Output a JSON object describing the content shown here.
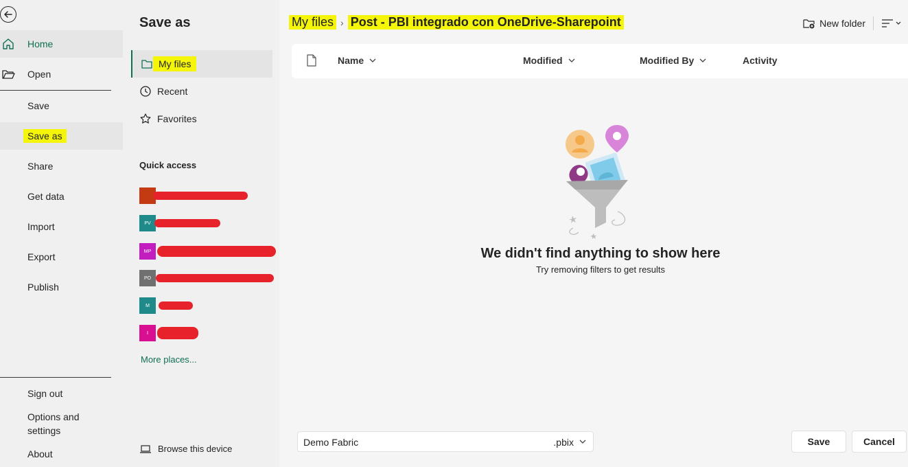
{
  "nav": {
    "home": "Home",
    "open": "Open",
    "save": "Save",
    "save_as": "Save as",
    "share": "Share",
    "get_data": "Get data",
    "import": "Import",
    "export": "Export",
    "publish": "Publish",
    "sign_out": "Sign out",
    "options_line1": "Options and",
    "options_line2": "settings",
    "about": "About"
  },
  "panel": {
    "title": "Save as",
    "locations": [
      "My files",
      "Recent",
      "Favorites"
    ],
    "quick_access_title": "Quick access",
    "quick_access": [
      {
        "initials": "",
        "color": "#c43a12"
      },
      {
        "initials": "PV",
        "color": "#1f8a8a"
      },
      {
        "initials": "MP",
        "color": "#c21ebf"
      },
      {
        "initials": "PO",
        "color": "#707070"
      },
      {
        "initials": "M",
        "color": "#1f8a8a"
      },
      {
        "initials": "I",
        "color": "#d80f90"
      }
    ],
    "more_places": "More places...",
    "browse": "Browse this device"
  },
  "breadcrumb": {
    "root": "My files",
    "current": "Post - PBI integrado con OneDrive-Sharepoint"
  },
  "toolbar": {
    "new_folder": "New folder"
  },
  "table": {
    "columns": [
      "Name",
      "Modified",
      "Modified By",
      "Activity"
    ]
  },
  "empty": {
    "title": "We didn't find anything to show here",
    "subtitle": "Try removing filters to get results"
  },
  "footer": {
    "filename": "Demo Fabric",
    "extension": ".pbix",
    "save": "Save",
    "cancel": "Cancel"
  }
}
